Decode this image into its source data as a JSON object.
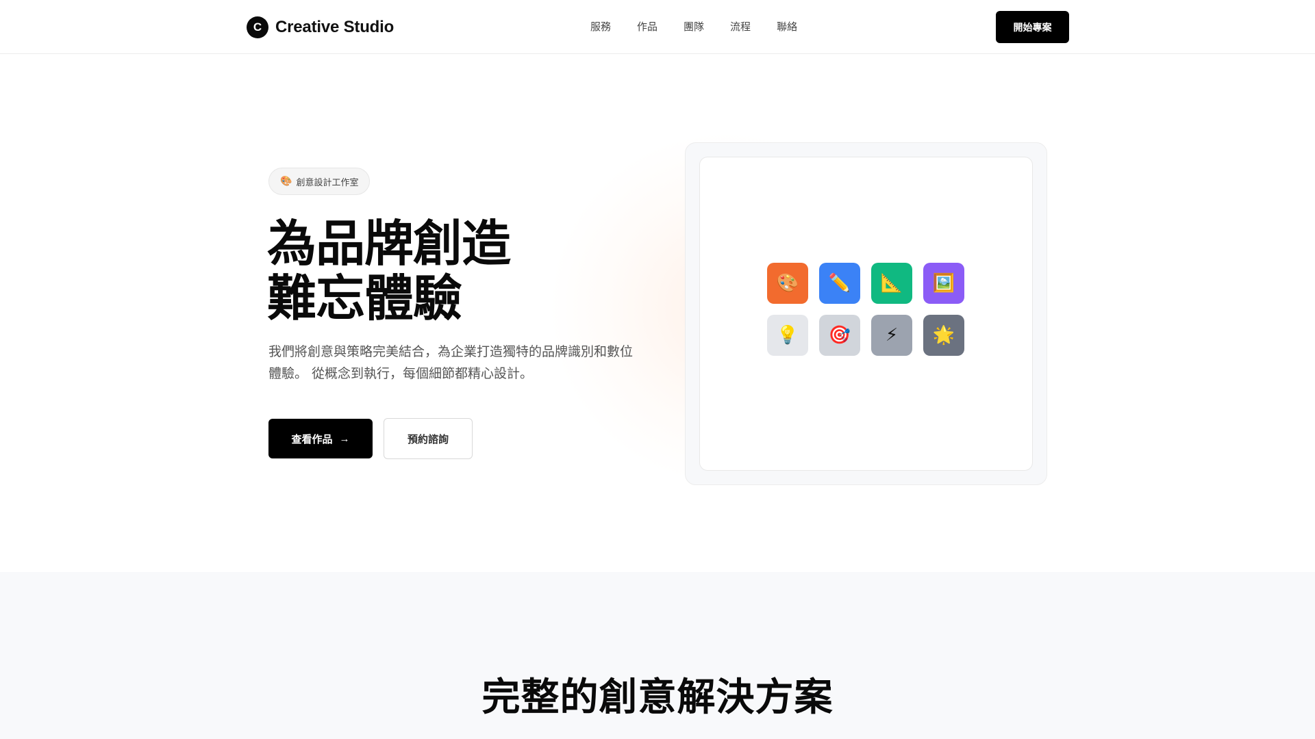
{
  "header": {
    "logo_mark": "C",
    "logo_text": "Creative Studio",
    "nav": [
      "服務",
      "作品",
      "團隊",
      "流程",
      "聯絡"
    ],
    "cta_label": "開始專案"
  },
  "hero": {
    "badge_icon": "🎨",
    "badge_text": "創意設計工作室",
    "title_line1": "為品牌創造",
    "title_line2": "難忘體驗",
    "description": "我們將創意與策略完美結合，為企業打造獨特的品牌識別和數位體驗。 從概念到執行，每個細節都精心設計。",
    "primary_button": "查看作品",
    "primary_arrow": "→",
    "secondary_button": "預約諮詢",
    "tiles": [
      {
        "emoji": "🎨",
        "name": "palette-icon",
        "color": "#f26b2e"
      },
      {
        "emoji": "✏️",
        "name": "pencil-icon",
        "color": "#3b82f6"
      },
      {
        "emoji": "📐",
        "name": "triangle-ruler-icon",
        "color": "#10b981"
      },
      {
        "emoji": "🖼️",
        "name": "framed-picture-icon",
        "color": "#8b5cf6"
      },
      {
        "emoji": "💡",
        "name": "light-bulb-icon",
        "color": "#e5e7eb"
      },
      {
        "emoji": "🎯",
        "name": "target-icon",
        "color": "#d1d5db"
      },
      {
        "emoji": "⚡",
        "name": "lightning-icon",
        "color": "#9ca3af"
      },
      {
        "emoji": "🌟",
        "name": "star-icon",
        "color": "#6b7280"
      }
    ]
  },
  "services": {
    "title": "完整的創意解決方案"
  }
}
